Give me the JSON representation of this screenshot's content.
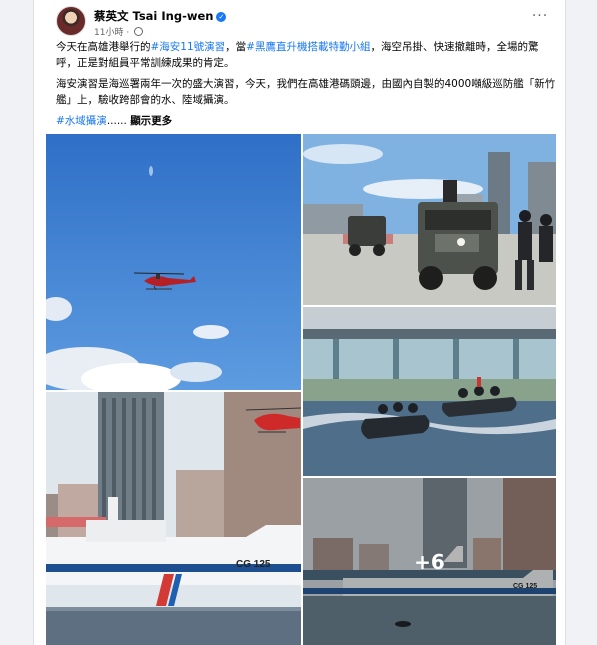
{
  "post": {
    "author": "蔡英文 Tsai Ing-wen",
    "time": "11小時",
    "more_icon": "more-dots-icon",
    "paragraph1": {
      "t1": "今天在高雄港舉行的",
      "tag1": "#海安11號演習",
      "t2": "，當",
      "tag2": "#黑鷹直升機搭載特勤小組",
      "t3": "，海空吊掛、快速撤離時，全場的驚呼，正是對組員平常訓練成果的肯定。"
    },
    "paragraph2": "海安演習是海巡署兩年一次的盛大演習，今天，我們在高雄港碼頭邊，由國內自製的4000噸級巡防艦「新竹艦」上，驗收跨部會的水、陸域攝演。",
    "tag3": "#水域攝演",
    "ellipsis": "......",
    "see_more": "顯示更多"
  },
  "photos": {
    "more_count": "+6",
    "ship_label_a": "CG 125",
    "ship_label_b": "CG 125"
  },
  "colors": {
    "link": "#1877f2",
    "sky": "#3f80d0",
    "water": "#5d6f80"
  }
}
